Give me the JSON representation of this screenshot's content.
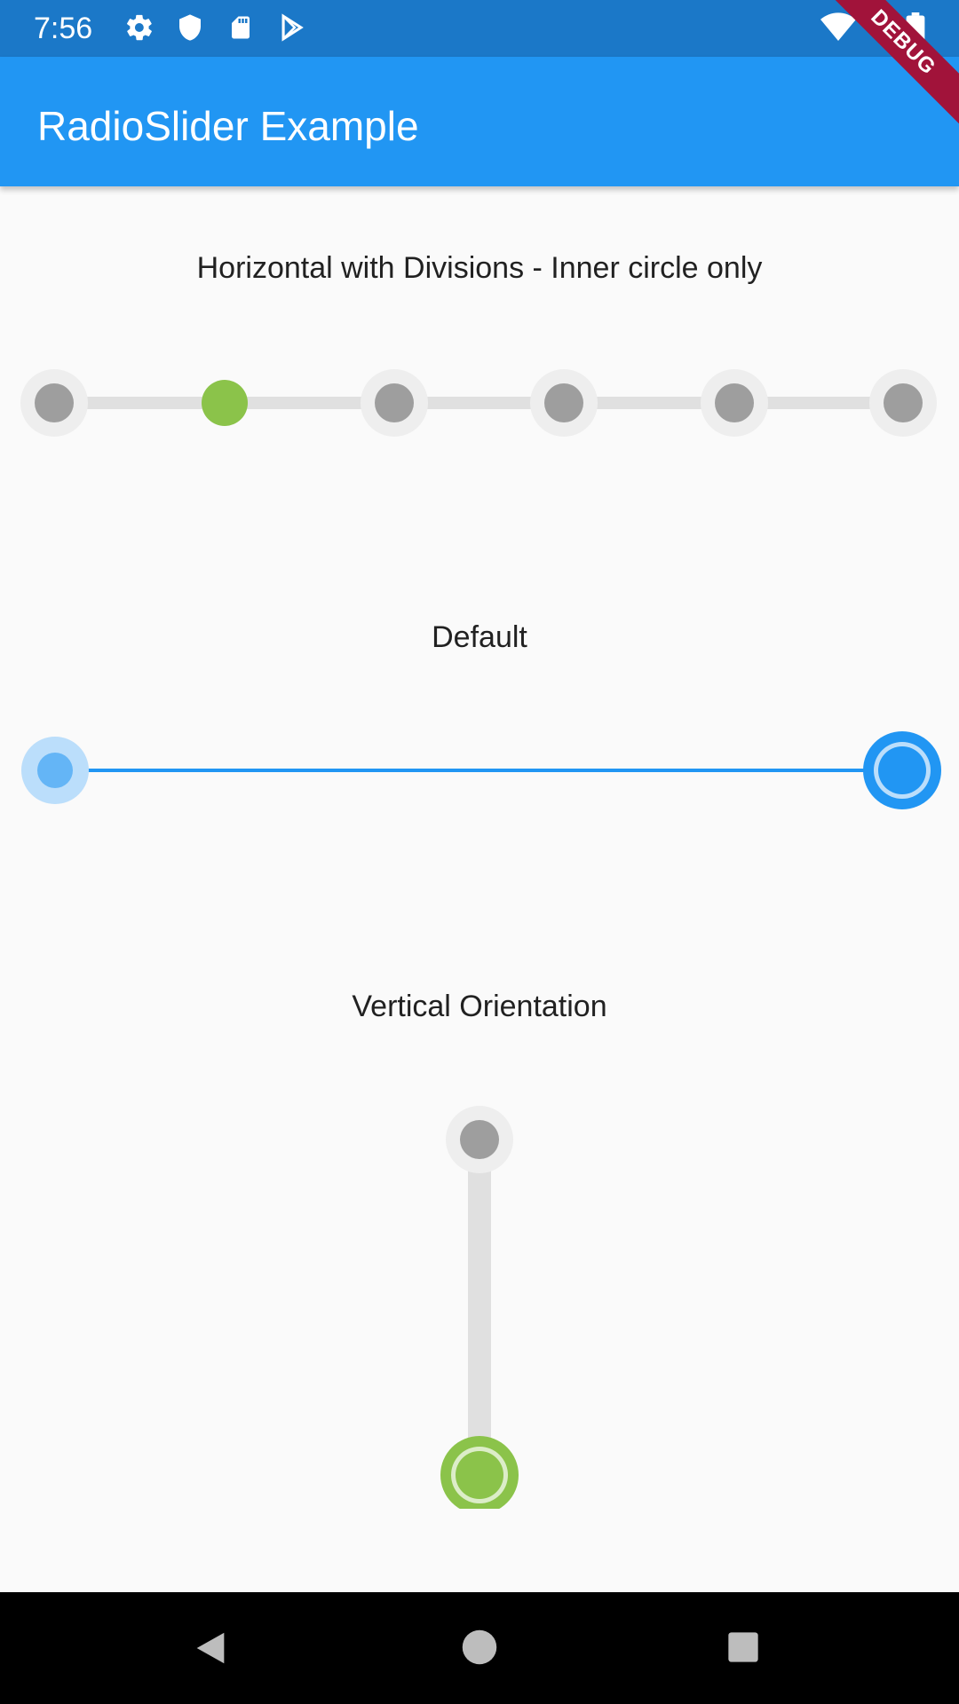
{
  "status_bar": {
    "time": "7:56",
    "left_icons": [
      "gear-icon",
      "shield-icon",
      "sd-card-icon",
      "play-store-icon"
    ],
    "right_icons": [
      "wifi-icon",
      "battery-icon"
    ]
  },
  "app_bar": {
    "title": "RadioSlider Example",
    "debug_banner": "DEBUG"
  },
  "sections": {
    "horizontal": {
      "title": "Horizontal with Divisions - Inner circle only",
      "divisions": 6,
      "selected_index": 1,
      "selected_color": "#8bc34a",
      "dot_color": "#9e9e9e",
      "track_color": "#e0e0e0"
    },
    "default": {
      "title": "Default",
      "selected_index": 4,
      "divisions": 5,
      "accent_color": "#2196f3"
    },
    "vertical": {
      "title": "Vertical Orientation",
      "divisions": 2,
      "selected_index": 1,
      "selected_color": "#8bc34a"
    }
  },
  "nav_bar": {
    "buttons": [
      "back-icon",
      "home-icon",
      "recents-icon"
    ]
  }
}
